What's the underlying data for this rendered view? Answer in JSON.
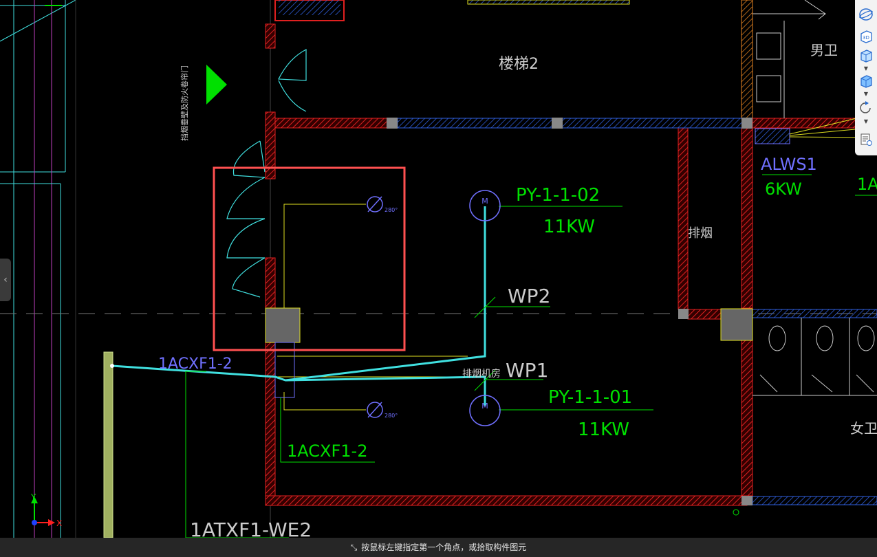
{
  "drawing": {
    "room_labels": {
      "stair": "楼梯2",
      "male_wc": "男卫",
      "female_wc": "女卫",
      "smoke_shaft": "排烟",
      "fan_room": "排烟机房",
      "side_note": "挡烟垂壁及防火卷帘门"
    },
    "equipment": [
      {
        "tag": "PY-1-1-02",
        "power": "11KW"
      },
      {
        "tag": "PY-1-1-01",
        "power": "11KW"
      }
    ],
    "panel": {
      "tag": "ALWS1",
      "power": "6KW",
      "partial_tag": "1A"
    },
    "circuits": {
      "wp2": "WP2",
      "wp1": "WP1"
    },
    "cables": {
      "upper": "1ACXF1-2",
      "lower": "1ACXF1-2",
      "bottom": "1ATXF1-WE2"
    },
    "dampers": [
      {
        "size": "280°"
      },
      {
        "size": "280°"
      }
    ],
    "motor_symbol": "M",
    "axes": {
      "y": "Y",
      "x": "X"
    }
  },
  "toolbar": {
    "buttons": [
      {
        "name": "orbit-icon"
      },
      {
        "name": "3d-view-icon",
        "label": "3D"
      },
      {
        "name": "box-view-icon"
      },
      {
        "name": "cube-view-icon"
      },
      {
        "name": "rotate-icon"
      },
      {
        "name": "properties-icon"
      }
    ],
    "arrow": "▼"
  },
  "left_handle": {
    "glyph": "‹"
  },
  "status": {
    "icon_glyph": "⤡",
    "prompt": "按鼠标左键指定第一个角点，或拾取构件图元"
  },
  "colors": {
    "wall": "#e02020",
    "cyan": "#40e0e0",
    "green": "#00e000",
    "blue": "#7070ff",
    "yellow": "#e0e020",
    "selection": "#ff5050"
  }
}
